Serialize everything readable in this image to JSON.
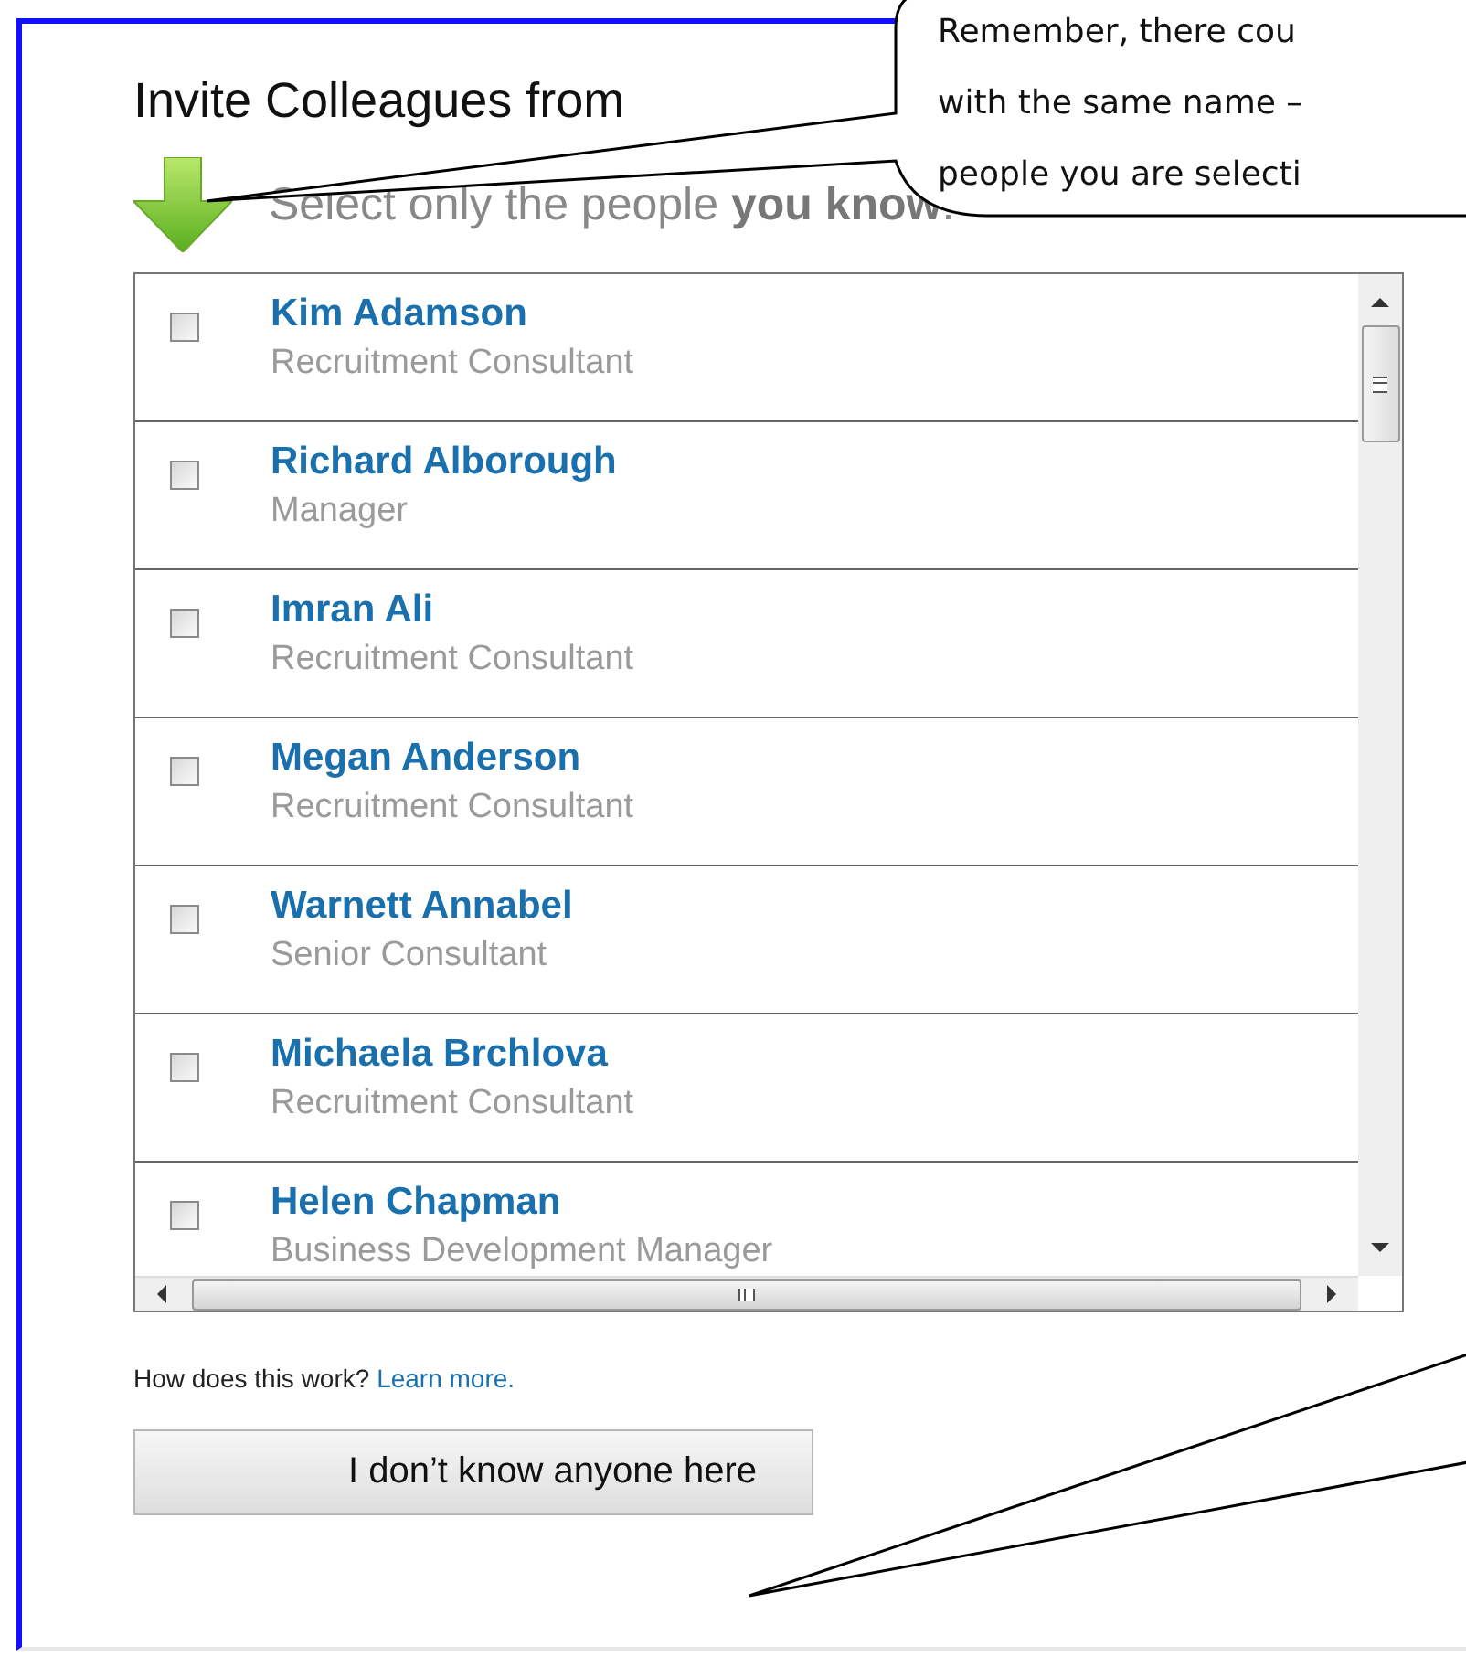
{
  "title": "Invite Colleagues from",
  "instruction": "Select only the people **you know**:",
  "people": [
    {
      "name": "Kim Adamson",
      "role": "Recruitment Consultant",
      "checked": false
    },
    {
      "name": "Richard Alborough",
      "role": "Manager",
      "checked": false
    },
    {
      "name": "Imran Ali",
      "role": "Recruitment Consultant",
      "checked": false
    },
    {
      "name": "Megan Anderson",
      "role": "Recruitment Consultant",
      "checked": false
    },
    {
      "name": "Warnett Annabel",
      "role": "Senior Consultant",
      "checked": false
    },
    {
      "name": "Michaela Brchlova",
      "role": "Recruitment Consultant",
      "checked": false
    },
    {
      "name": "Helen Chapman",
      "role": "Business Development Manager",
      "checked": false
    }
  ],
  "help": {
    "question": "How does this work?",
    "link": "Learn more."
  },
  "button": "I don’t know anyone here",
  "callout": {
    "lines": [
      "Remember, there cou",
      "with the same name –",
      "people you are selecti"
    ]
  }
}
